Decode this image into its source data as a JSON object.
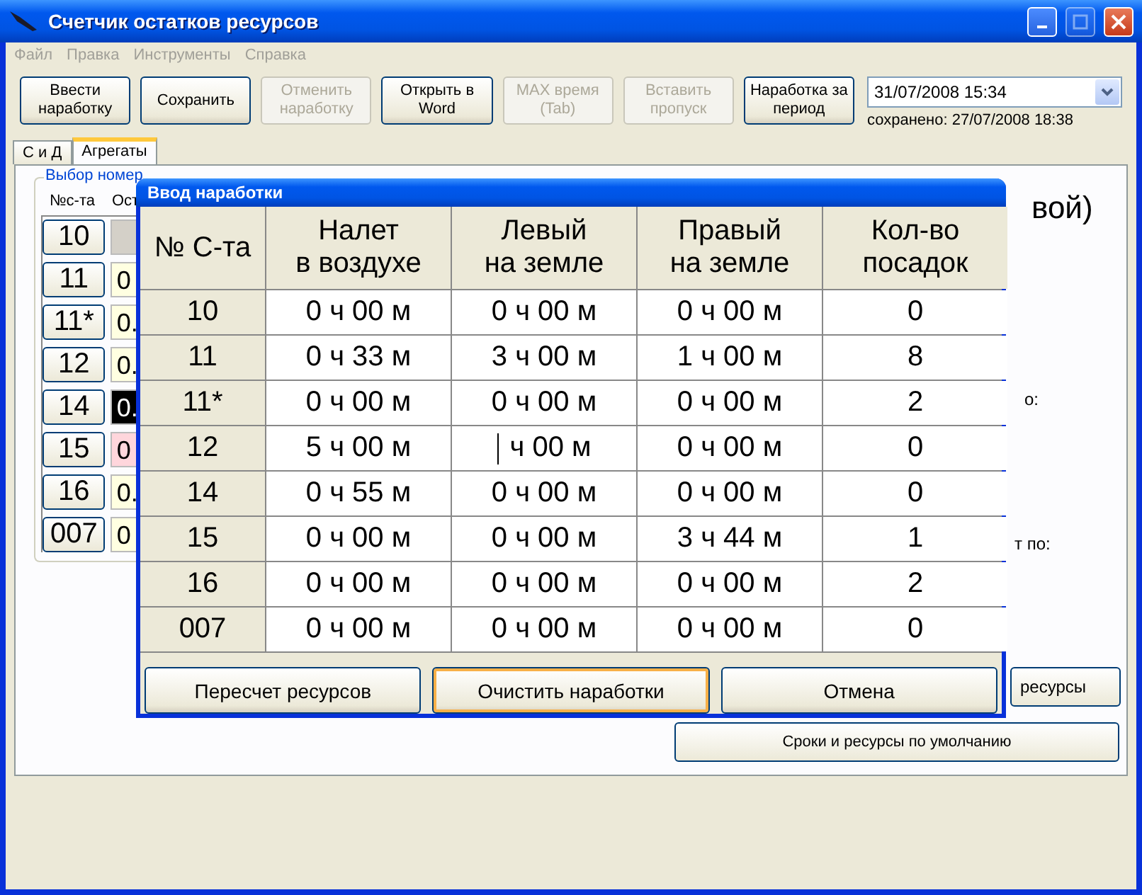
{
  "window": {
    "title": "Счетчик остатков ресурсов"
  },
  "menu": [
    {
      "label": "Файл",
      "disabled": true
    },
    {
      "label": "Правка",
      "disabled": true
    },
    {
      "label": "Инструменты",
      "disabled": true
    },
    {
      "label": "Справка",
      "disabled": true
    }
  ],
  "toolbar": [
    {
      "label": "Ввести наработку",
      "disabled": false
    },
    {
      "label": "Сохранить",
      "disabled": false
    },
    {
      "label": "Отменить наработку",
      "disabled": true
    },
    {
      "label": "Открыть в Word",
      "disabled": false
    },
    {
      "label": "MAX время (Tab)",
      "disabled": true
    },
    {
      "label": "Вставить пропуск",
      "disabled": true
    },
    {
      "label": "Наработка за период",
      "disabled": false
    }
  ],
  "date_picker": {
    "value": "31/07/2008 15:34",
    "saved": "сохранено: 27/07/2008 18:38"
  },
  "tabs": [
    {
      "label": "С и Д",
      "selected": false
    },
    {
      "label": "Агрегаты",
      "selected": true
    }
  ],
  "group": {
    "legend": "Выбор номер",
    "headers": [
      "№с-та",
      "Ост"
    ],
    "rows": [
      {
        "number": "10",
        "color": "#d4d0c8"
      },
      {
        "number": "11",
        "value": "0",
        "color": "#ffffe1"
      },
      {
        "number": "11*",
        "value": "0.",
        "color": "#ffffe1"
      },
      {
        "number": "12",
        "value": "0.",
        "color": "#ffffe1"
      },
      {
        "number": "14",
        "value": "0.",
        "color": "#000000"
      },
      {
        "number": "15",
        "value": "0",
        "color": "#ffd6dc"
      },
      {
        "number": "16",
        "value": "0.",
        "color": "#ffffe1"
      },
      {
        "number": "007",
        "value": "0",
        "color": "#ffffe1"
      }
    ]
  },
  "right_panel": {
    "texts": [
      "вой)",
      "о:",
      "т по:"
    ],
    "button": "ресурсы",
    "defaults_button": "Сроки и ресурсы по умолчанию"
  },
  "dialog": {
    "title": "Ввод наработки",
    "columns": [
      "№ С-та",
      "Налет\nв воздухе",
      "Левый\nна земле",
      "Правый\nна земле",
      "Кол-во\nпосадок"
    ],
    "rows": [
      {
        "number": "10",
        "values": [
          "0 ч 00 м",
          "0 ч 00 м",
          "0 ч 00 м",
          "0"
        ],
        "cursor": [
          false,
          false,
          false,
          false
        ]
      },
      {
        "number": "11",
        "values": [
          "0 ч 33 м",
          "3 ч 00 м",
          "1 ч 00 м",
          "8"
        ],
        "cursor": [
          false,
          false,
          false,
          false
        ]
      },
      {
        "number": "11*",
        "values": [
          "0 ч 00 м",
          "0 ч 00 м",
          "0 ч 00 м",
          "2"
        ],
        "cursor": [
          false,
          false,
          false,
          false
        ]
      },
      {
        "number": "12",
        "values": [
          "5 ч 00 м",
          "ч 00 м",
          "0 ч 00 м",
          "0"
        ],
        "cursor": [
          false,
          true,
          false,
          false
        ]
      },
      {
        "number": "14",
        "values": [
          "0 ч 55 м",
          "0 ч 00 м",
          "0 ч 00 м",
          "0"
        ],
        "cursor": [
          false,
          false,
          false,
          false
        ]
      },
      {
        "number": "15",
        "values": [
          "0 ч 00 м",
          "0 ч 00 м",
          "3 ч 44 м",
          "1"
        ],
        "cursor": [
          false,
          false,
          false,
          false
        ]
      },
      {
        "number": "16",
        "values": [
          "0 ч 00 м",
          "0 ч 00 м",
          "0 ч 00 м",
          "2"
        ],
        "cursor": [
          false,
          false,
          false,
          false
        ]
      },
      {
        "number": "007",
        "values": [
          "0 ч 00 м",
          "0 ч 00 м",
          "0 ч 00 м",
          "0"
        ],
        "cursor": [
          false,
          false,
          false,
          false
        ]
      }
    ],
    "buttons": [
      {
        "label": "Пересчет ресурсов",
        "focused": false
      },
      {
        "label": "Очистить наработки",
        "focused": true
      },
      {
        "label": "Отмена",
        "focused": false
      }
    ]
  }
}
